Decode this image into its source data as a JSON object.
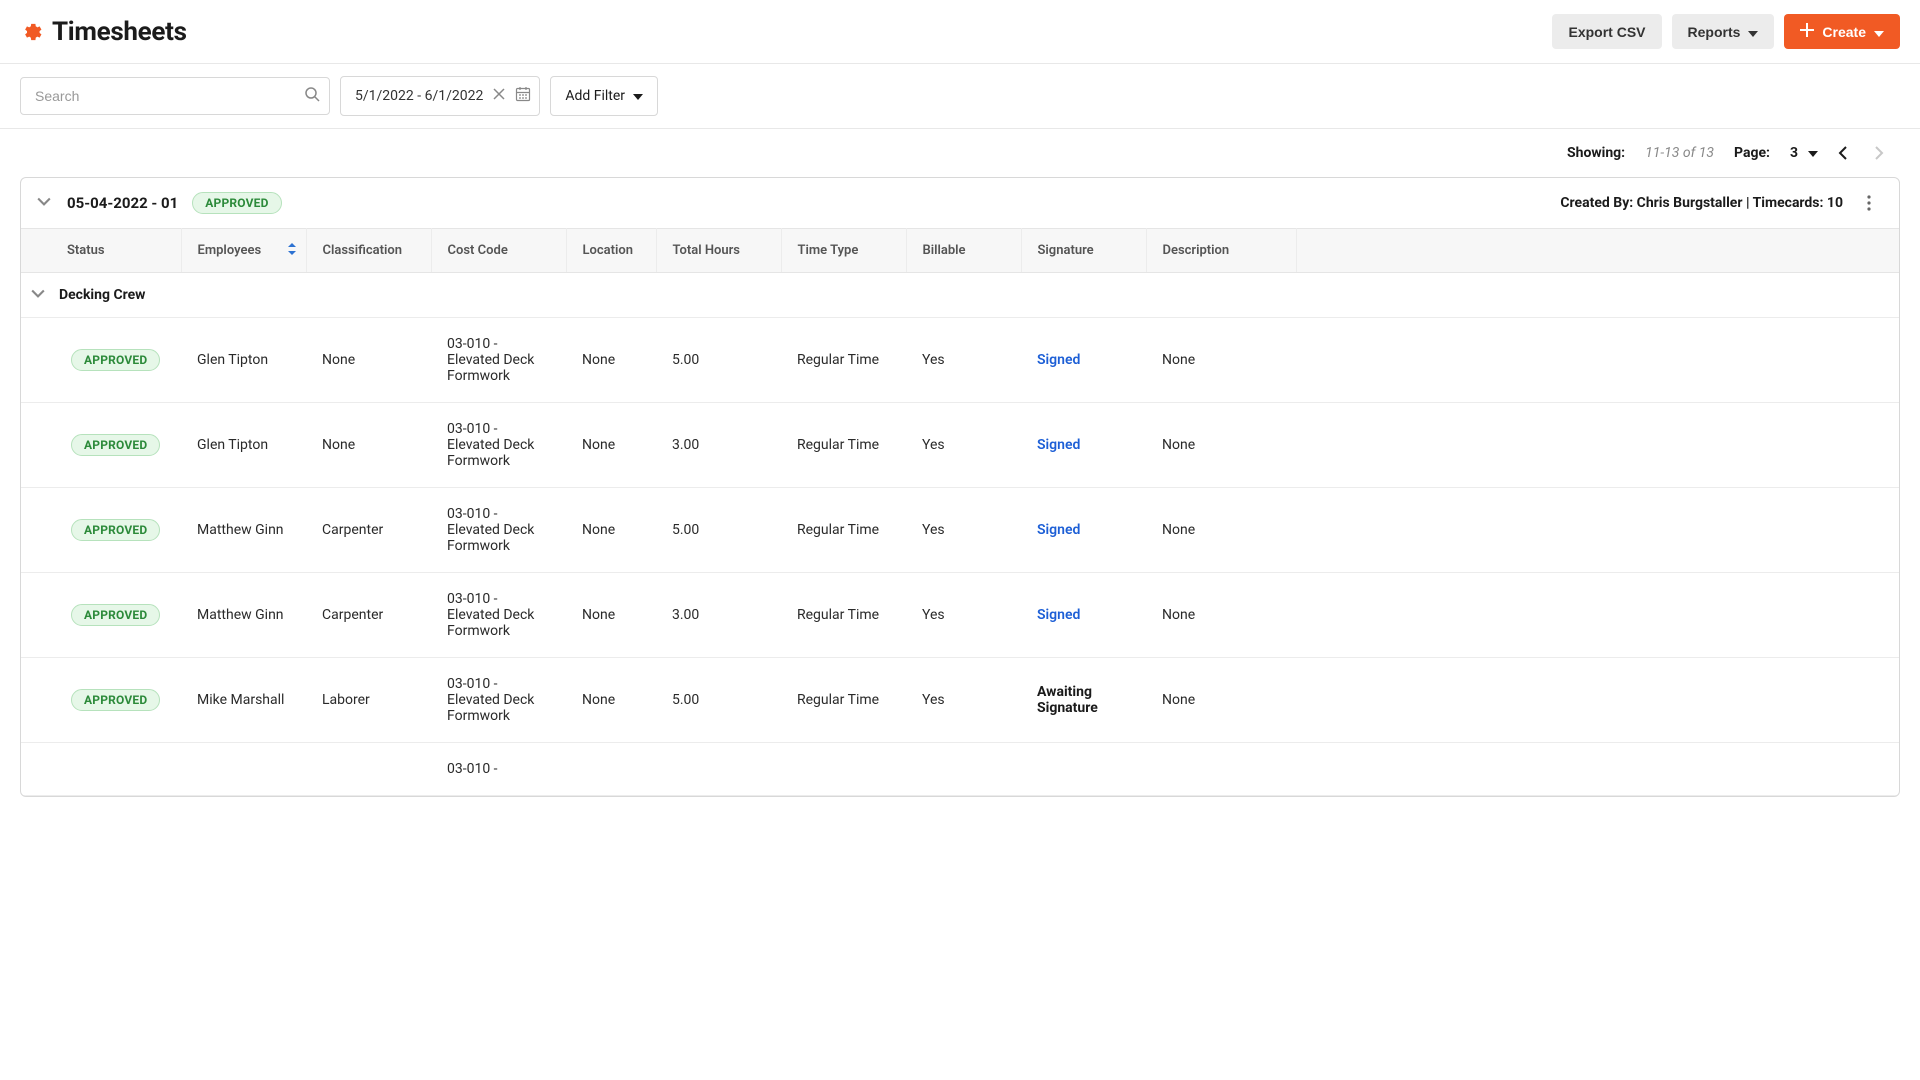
{
  "header": {
    "title": "Timesheets",
    "export_label": "Export CSV",
    "reports_label": "Reports",
    "create_label": "Create"
  },
  "filters": {
    "search_placeholder": "Search",
    "date_range": "5/1/2022 - 6/1/2022",
    "add_filter_label": "Add Filter"
  },
  "pagination": {
    "showing_label": "Showing:",
    "showing_value": "11-13 of 13",
    "page_label": "Page:",
    "page_value": "3"
  },
  "sheet": {
    "title": "05-04-2022 - 01",
    "status": "APPROVED",
    "meta": "Created By: Chris Burgstaller | Timecards: 10"
  },
  "columns": {
    "status": "Status",
    "employees": "Employees",
    "classification": "Classification",
    "cost_code": "Cost Code",
    "location": "Location",
    "total_hours": "Total Hours",
    "time_type": "Time Type",
    "billable": "Billable",
    "signature": "Signature",
    "description": "Description"
  },
  "group": {
    "name": "Decking Crew"
  },
  "rows": [
    {
      "status": "APPROVED",
      "employee": "Glen Tipton",
      "classification": "None",
      "cost_code": "03-010 - Elevated Deck Formwork",
      "location": "None",
      "total_hours": "5.00",
      "time_type": "Regular Time",
      "billable": "Yes",
      "signature": "Signed",
      "signature_kind": "link",
      "description": "None"
    },
    {
      "status": "APPROVED",
      "employee": "Glen Tipton",
      "classification": "None",
      "cost_code": "03-010 - Elevated Deck Formwork",
      "location": "None",
      "total_hours": "3.00",
      "time_type": "Regular Time",
      "billable": "Yes",
      "signature": "Signed",
      "signature_kind": "link",
      "description": "None"
    },
    {
      "status": "APPROVED",
      "employee": "Matthew Ginn",
      "classification": "Carpenter",
      "cost_code": "03-010 - Elevated Deck Formwork",
      "location": "None",
      "total_hours": "5.00",
      "time_type": "Regular Time",
      "billable": "Yes",
      "signature": "Signed",
      "signature_kind": "link",
      "description": "None"
    },
    {
      "status": "APPROVED",
      "employee": "Matthew Ginn",
      "classification": "Carpenter",
      "cost_code": "03-010 - Elevated Deck Formwork",
      "location": "None",
      "total_hours": "3.00",
      "time_type": "Regular Time",
      "billable": "Yes",
      "signature": "Signed",
      "signature_kind": "link",
      "description": "None"
    },
    {
      "status": "APPROVED",
      "employee": "Mike Marshall",
      "classification": "Laborer",
      "cost_code": "03-010 - Elevated Deck Formwork",
      "location": "None",
      "total_hours": "5.00",
      "time_type": "Regular Time",
      "billable": "Yes",
      "signature": "Awaiting Signature",
      "signature_kind": "await",
      "description": "None"
    },
    {
      "status": "",
      "employee": "",
      "classification": "",
      "cost_code": "03-010 -",
      "location": "",
      "total_hours": "",
      "time_type": "",
      "billable": "",
      "signature": "",
      "signature_kind": "",
      "description": ""
    }
  ]
}
